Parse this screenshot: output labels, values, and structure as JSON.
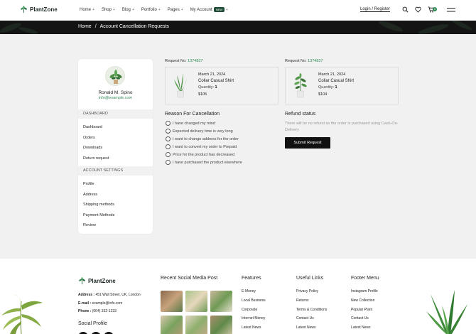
{
  "header": {
    "brand": "PlantZone",
    "nav": [
      {
        "label": "Home"
      },
      {
        "label": "Shop"
      },
      {
        "label": "Blog"
      },
      {
        "label": "Portfolio"
      },
      {
        "label": "Pages"
      },
      {
        "label": "My Account"
      }
    ],
    "new_badge": "NEW",
    "login": "Login / Register",
    "cart_count": "0"
  },
  "breadcrumb": {
    "home": "Home",
    "separator": "/",
    "current": "Account Cancellation Requests"
  },
  "sidebar": {
    "user_name": "Ronald M. Spino",
    "user_email": "info@example.com",
    "dashboard_head": "DASHBOARD",
    "dashboard_items": [
      "Dashboard",
      "Orders",
      "Downloads",
      "Return request"
    ],
    "settings_head": "ACCOUNT SETTINGS",
    "settings_items": [
      "Profile",
      "Address",
      "Shipping methods",
      "Payment Methods",
      "Review"
    ]
  },
  "requests": [
    {
      "label": "Request No:",
      "number": "1374837",
      "date": "March 21, 2024",
      "product": "Collar Casual Shirt",
      "qty_label": "Quantity:",
      "qty": "1",
      "price": "$105"
    },
    {
      "label": "Request No:",
      "number": "1374837",
      "date": "March 21, 2024",
      "product": "Collar Casual Shirt",
      "qty_label": "Quantity:",
      "qty": "1",
      "price": "$104"
    }
  ],
  "cancellation": {
    "title": "Reason For Cancellation",
    "reasons": [
      "I have changed my mind",
      "Expected delivery time is very long",
      "I want to change address for the order",
      "I want to convert my order to Prepaid",
      "Price for the product has decreased",
      "I have purchased the product elsewhere"
    ]
  },
  "refund": {
    "title": "Refund status",
    "text": "There will be no refund as the order is purchased using Cash-On-Delivery",
    "submit": "Submit Request"
  },
  "footer": {
    "brand": "PlantZone",
    "address_label": "Address :",
    "address": "451 Wall Street, UK, London",
    "email_label": "E-mail :",
    "email": "example@info.com",
    "phone_label": "Phone :",
    "phone": "(064) 332-1233",
    "social_title": "Social Profile",
    "recent_title": "Recent Social Media Post",
    "features_title": "Features",
    "features": [
      "E-Money",
      "Local Business",
      "Corporate",
      "Internet Money",
      "Latest News"
    ],
    "useful_title": "Useful Links",
    "useful": [
      "Privacy Policy",
      "Returns",
      "Terms & Conditions",
      "Contact Us",
      "Latest News"
    ],
    "menu_title": "Footer Menu",
    "menu": [
      "Instagram Profile",
      "New Collection",
      "Popular Plant",
      "Contact Us",
      "Latest News"
    ]
  },
  "colors": {
    "accent": "#2f8a55",
    "dark": "#111111",
    "badge": "#1d4d36"
  }
}
